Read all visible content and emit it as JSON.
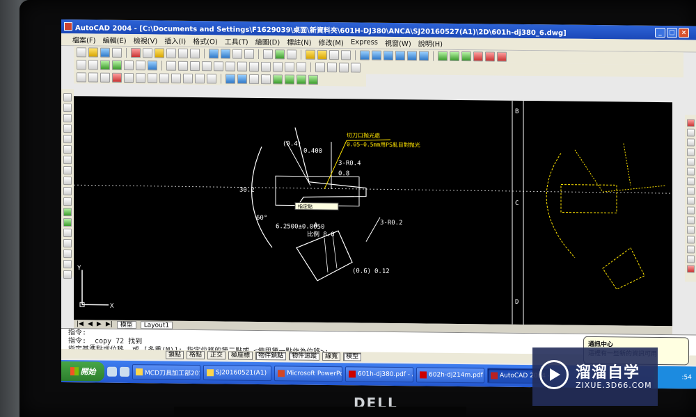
{
  "window": {
    "title": "AutoCAD 2004 - [C:\\Documents and Settings\\F1629039\\桌面\\新資料夾\\601H-DJ380\\ANCA\\SJ20160527(A1)\\2D\\601h-dj380_6.dwg]",
    "buttons": [
      "_",
      "□",
      "×"
    ]
  },
  "menu": [
    "檔案(F)",
    "編輯(E)",
    "檢視(V)",
    "插入(I)",
    "格式(O)",
    "工具(T)",
    "繪圖(D)",
    "標註(N)",
    "修改(M)",
    "Express",
    "視窗(W)",
    "說明(H)"
  ],
  "drawing": {
    "labels_white": [
      "0.400",
      "(0.4)",
      "3-R0.4",
      "0.8",
      "6.2500±0.0050",
      "30.2",
      "60°",
      "(0.6)",
      "0.12",
      "3-R0.2",
      "A",
      "比例 8.0"
    ],
    "annotation_yellow": [
      "切刀口抛光處",
      "0.05~0.5mm用PS亂目對抛光"
    ],
    "sheet_markers": [
      "B",
      "C",
      "D"
    ],
    "tooltip": "指定點 ",
    "axis": {
      "y": "Y",
      "x": "X"
    }
  },
  "tabs": {
    "nav": [
      "|◀",
      "◀",
      "▶",
      "▶|"
    ],
    "model": "模型",
    "layout": "Layout1"
  },
  "command": {
    "lines": [
      "指令:",
      "指令: _copy 72 找到",
      "指定基準點或位移, 或 [多重(M)]:  指定位移的第二點或 <使用第一點作為位移>:"
    ]
  },
  "status": [
    "鎖點",
    "格點",
    "正交",
    "極座標",
    "物件鎖點",
    "物件追蹤",
    "線寬",
    "模型"
  ],
  "taskbar": {
    "start": "開始",
    "tasks": [
      "MCD刀具加工部201...",
      "SJ20160521(A1)",
      "Microsoft PowerPoint ...",
      "601h-dj380.pdf - Ado...",
      "602h-dj214m.pdf - Ad...",
      "AutoCAD 2004 -..."
    ],
    "clock": ":54"
  },
  "balloon": {
    "title": "通訊中心",
    "body": "這裡有一些新的資訊可用"
  },
  "monitor_brand": "DELL",
  "watermark": {
    "title": "溜溜自学",
    "url": "ZIXUE.3D66.COM"
  }
}
